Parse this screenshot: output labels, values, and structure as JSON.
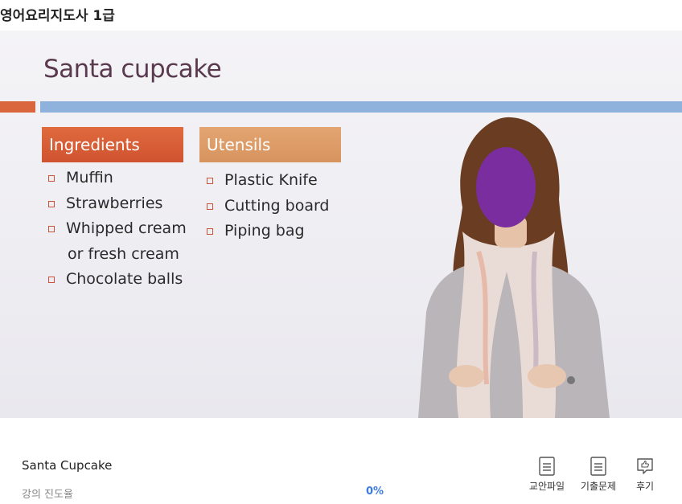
{
  "header": {
    "title": "영어요리지도사 1급"
  },
  "slide": {
    "title": "Santa cupcake",
    "ingredients": {
      "heading": "Ingredients",
      "items": [
        "Muffin",
        "Strawberries",
        "Whipped cream",
        "or fresh cream",
        "Chocolate balls"
      ]
    },
    "utensils": {
      "heading": "Utensils",
      "items": [
        "Plastic Knife",
        "Cutting board",
        "Piping bag"
      ]
    },
    "colors": {
      "title": "#5a3a4e",
      "accent_orange": "#d9663d",
      "accent_blue": "#8eb2dc",
      "utensils_header": "#dc9c68"
    }
  },
  "lecture": {
    "title": "Santa Cupcake",
    "progress_label": "강의 진도율",
    "progress_value": "0%",
    "progress_fraction": 0
  },
  "actions": [
    {
      "label": "교안파일",
      "icon": "document-icon"
    },
    {
      "label": "기출문제",
      "icon": "document-icon"
    },
    {
      "label": "후기",
      "icon": "thumbs-up-icon"
    }
  ]
}
